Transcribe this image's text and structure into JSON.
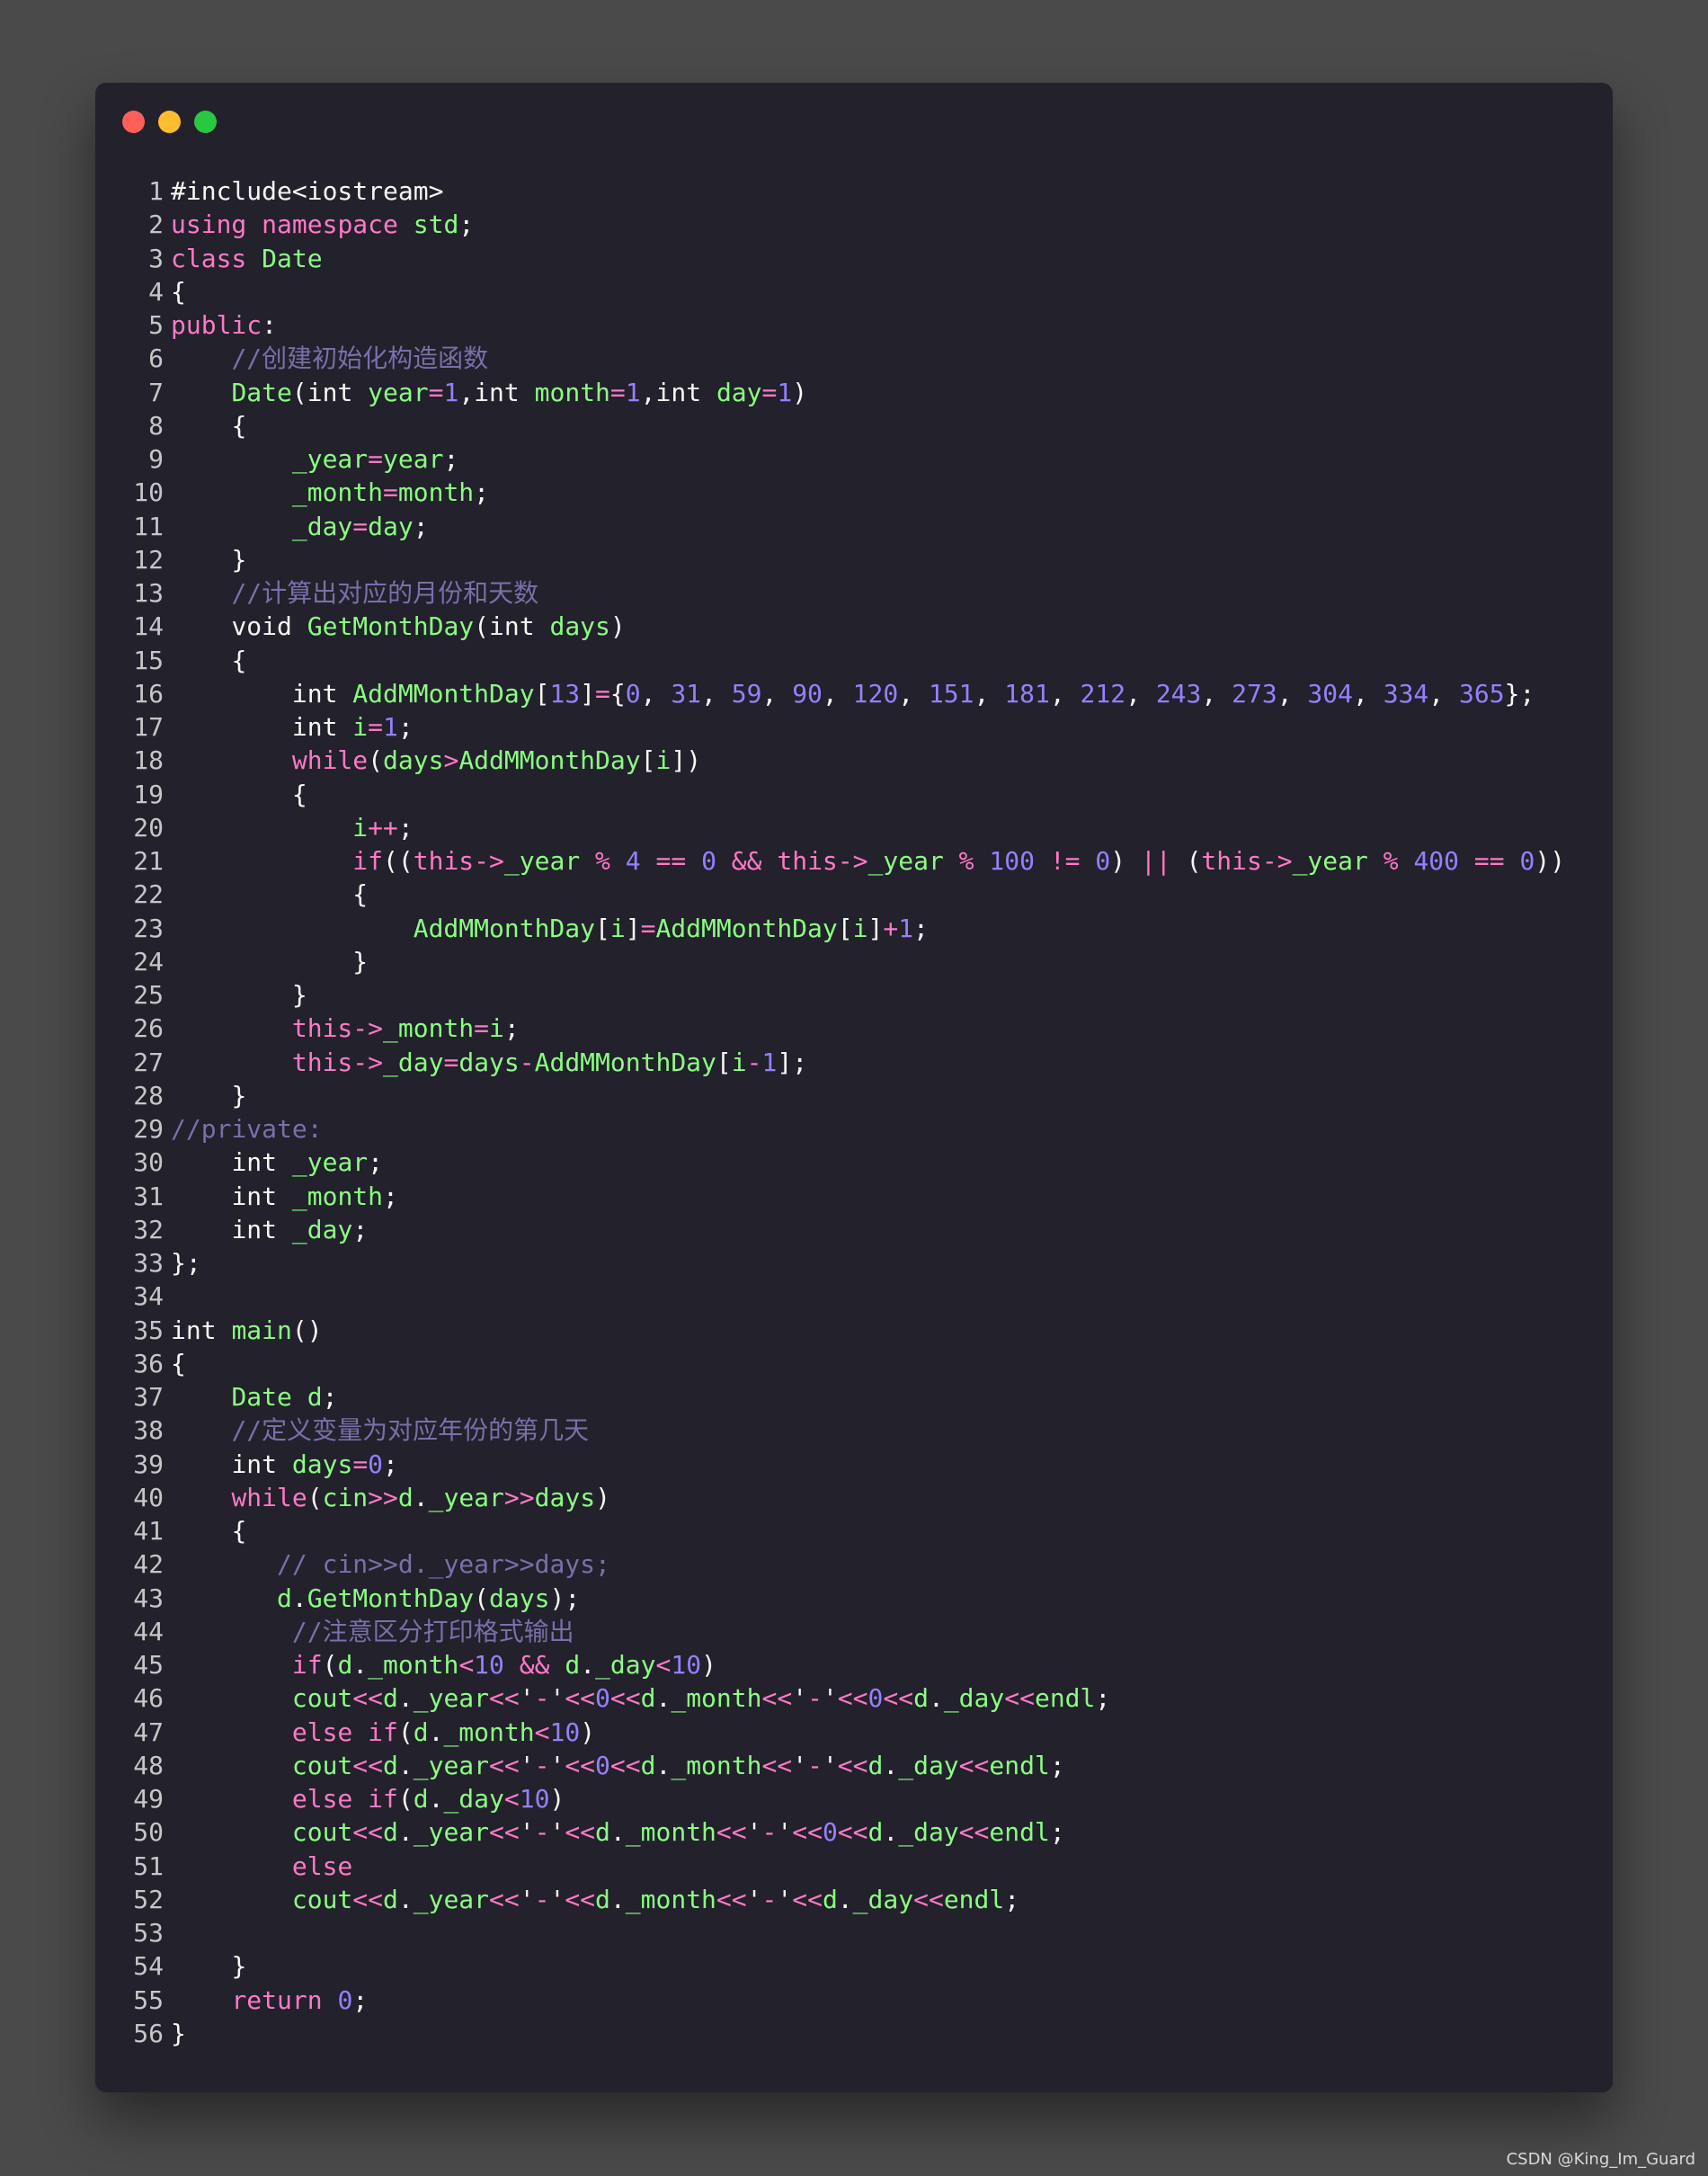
{
  "window": {
    "controls": [
      "close",
      "minimize",
      "maximize"
    ],
    "colors": {
      "close": "#ff5f57",
      "minimize": "#febc2e",
      "maximize": "#28c840",
      "background": "#22212c"
    }
  },
  "syntax_colors": {
    "keyword": "#ff79c6",
    "identifier": "#8aff80",
    "number": "#9580ff",
    "comment": "#7970a9",
    "plain": "#f8f8f2"
  },
  "code": {
    "language": "cpp",
    "lines": [
      "#include<iostream>",
      "using namespace std;",
      "class Date",
      "{",
      "public:",
      "    //创建初始化构造函数",
      "    Date(int year=1,int month=1,int day=1)",
      "    {",
      "        _year=year;",
      "        _month=month;",
      "        _day=day;",
      "    }",
      "    //计算出对应的月份和天数",
      "    void GetMonthDay(int days)",
      "    {",
      "        int AddMMonthDay[13]={0, 31, 59, 90, 120, 151, 181, 212, 243, 273, 304, 334, 365};",
      "        int i=1;",
      "        while(days>AddMMonthDay[i])",
      "        {",
      "            i++;",
      "            if((this->_year % 4 == 0 && this->_year % 100 != 0) || (this->_year % 400 == 0))",
      "            {",
      "                AddMMonthDay[i]=AddMMonthDay[i]+1;",
      "            }",
      "        }",
      "        this->_month=i;",
      "        this->_day=days-AddMMonthDay[i-1];",
      "    }",
      "//private:",
      "    int _year;",
      "    int _month;",
      "    int _day;",
      "};",
      "",
      "int main()",
      "{",
      "    Date d;",
      "    //定义变量为对应年份的第几天",
      "    int days=0;",
      "    while(cin>>d._year>>days)",
      "    {",
      "       // cin>>d._year>>days;",
      "       d.GetMonthDay(days);",
      "        //注意区分打印格式输出",
      "        if(d._month<10 && d._day<10)",
      "        cout<<d._year<<'-'<<0<<d._month<<'-'<<0<<d._day<<endl;",
      "        else if(d._month<10)",
      "        cout<<d._year<<'-'<<0<<d._month<<'-'<<d._day<<endl;",
      "        else if(d._day<10)",
      "        cout<<d._year<<'-'<<d._month<<'-'<<0<<d._day<<endl;",
      "        else",
      "        cout<<d._year<<'-'<<d._month<<'-'<<d._day<<endl;",
      "",
      "    }",
      "    return 0;",
      "}"
    ]
  },
  "watermark": "CSDN @King_Im_Guard"
}
